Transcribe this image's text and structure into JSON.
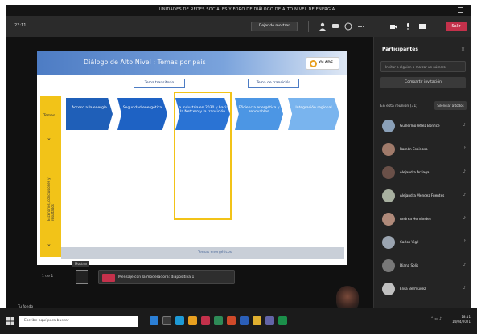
{
  "window": {
    "title": "UNIDADES DE REDES SOCIALES Y FORO DE DIÁLOGO DE ALTO NIVEL DE ENERGÍA"
  },
  "toolbar": {
    "timer": "23:11",
    "stop_share_label": "Dejar de mostrar",
    "leave_label": "Salir"
  },
  "slide": {
    "title": "Diálogo de Alto Nivel : Temas por país",
    "logo_text": "OLADE",
    "bracket_left": "Tema transitorio",
    "bracket_right": "Tema de transición",
    "left_label": "Temas",
    "left_vertical": "Escenarios, conclusiones y resultados",
    "stages": [
      "Acceso a la energía",
      "Seguridad energética",
      "La industria en 2030 y hacia la Netcero y la transición",
      "Eficiencia energética y renovables",
      "Integración regional"
    ],
    "bottom_label": "Temas energéticos",
    "left_bottom": "Resultados"
  },
  "presenter": {
    "page_label": "1 de 1",
    "message": "Mensaje con la moderadora: diapositiva 1",
    "tooltip": "Mostrar"
  },
  "stage_name": "Tu fondo",
  "panel": {
    "title": "Participantes",
    "invite_placeholder": "Invitar a alguien o marcar un número",
    "share_label": "Compartir invitación",
    "section_label": "En esta reunión (31)",
    "mute_all_label": "Silenciar a todos",
    "participants": [
      {
        "name": "Guillermo Vélez Bonfice"
      },
      {
        "name": "Ramón Espinosa"
      },
      {
        "name": "Alejandra Arriaga"
      },
      {
        "name": "Alejandra Mendez Fuentes"
      },
      {
        "name": "Andrea Hernández"
      },
      {
        "name": "Carlos Vigil"
      },
      {
        "name": "Diana Solis"
      },
      {
        "name": "Elisa Bermúdez"
      }
    ]
  },
  "taskbar": {
    "search_placeholder": "Escribe aquí para buscar",
    "time": "18:11",
    "date": "14/04/2021"
  }
}
